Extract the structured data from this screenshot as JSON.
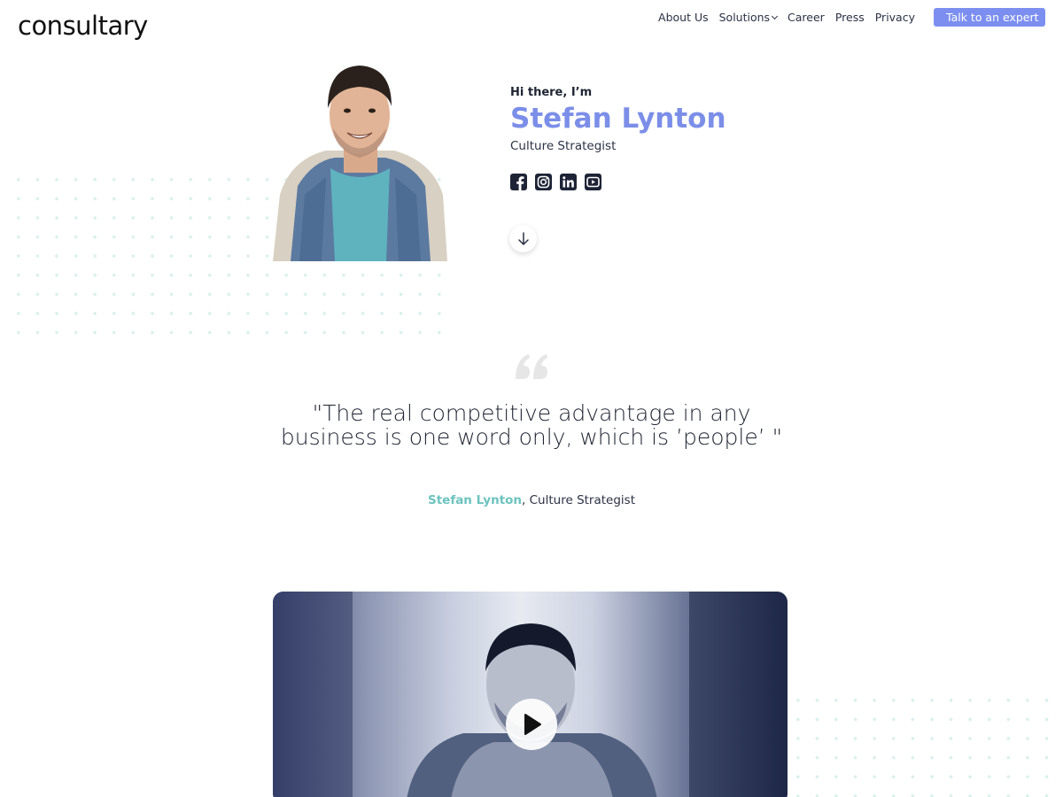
{
  "header": {
    "logo": "consultary",
    "nav": [
      {
        "label": "About Us"
      },
      {
        "label": "Solutions"
      },
      {
        "label": "Career"
      },
      {
        "label": "Press"
      },
      {
        "label": "Privacy"
      }
    ],
    "cta_label": "Talk to an expert"
  },
  "hero": {
    "greeting": "Hi there, I’m",
    "name": "Stefan Lynton",
    "role": "Culture Strategist",
    "socials": [
      "facebook-icon",
      "instagram-icon",
      "linkedin-icon",
      "youtube-icon"
    ]
  },
  "quote": {
    "text": "\"The real competitive advantage in any business is one word only, which is ’people’ \"",
    "author_name": "Stefan Lynton",
    "author_suffix": ", Culture Strategist"
  },
  "colors": {
    "accent": "#7b8ee8",
    "teal": "#6cc3bf",
    "dark": "#1e2436",
    "button": "#7c8ff0"
  }
}
